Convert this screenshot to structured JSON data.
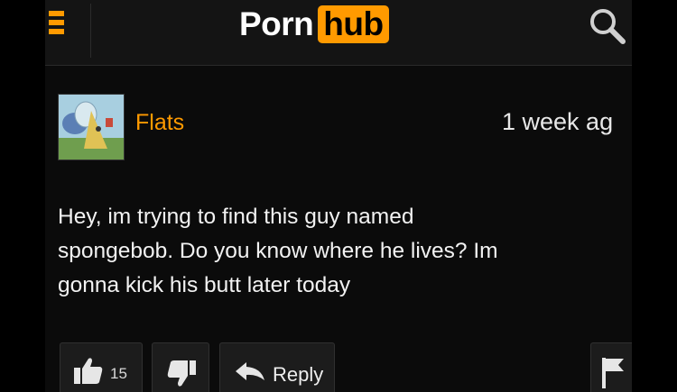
{
  "header": {
    "logo_left": "Porn",
    "logo_right": "hub",
    "menu_icon": "hamburger-menu-icon",
    "search_icon": "search-icon",
    "accent_color": "#ff9a00"
  },
  "comment": {
    "username": "Flats",
    "timestamp": "1 week ag",
    "body_lines": [
      "Hey, im trying to find this guy named",
      "spongebob. Do you know where he lives? Im",
      "gonna kick his butt later today"
    ],
    "avatar_icon": "user-avatar"
  },
  "actions": {
    "like_count": "15",
    "like_icon": "thumbs-up-icon",
    "dislike_icon": "thumbs-down-icon",
    "reply_label": "Reply",
    "reply_icon": "reply-arrow-icon",
    "flag_icon": "flag-icon"
  }
}
